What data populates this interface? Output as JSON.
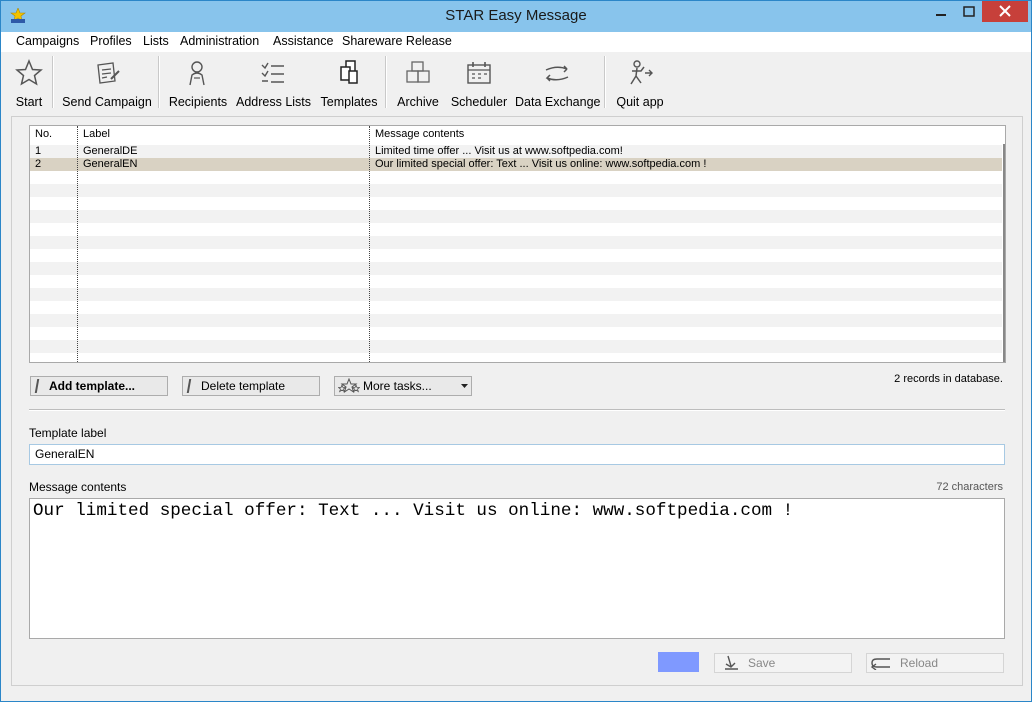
{
  "window": {
    "title": "STAR Easy Message"
  },
  "menu": [
    "Campaigns",
    "Profiles",
    "Lists",
    "Administration",
    "Assistance",
    "Shareware Release"
  ],
  "toolbar": [
    {
      "label": "Start",
      "icon": "star-icon"
    },
    {
      "label": "Send Campaign",
      "icon": "send-campaign-icon"
    },
    {
      "label": "Recipients",
      "icon": "recipients-icon"
    },
    {
      "label": "Address Lists",
      "icon": "address-lists-icon"
    },
    {
      "label": "Templates",
      "icon": "templates-icon"
    },
    {
      "label": "Archive",
      "icon": "archive-icon"
    },
    {
      "label": "Scheduler",
      "icon": "scheduler-icon"
    },
    {
      "label": "Data Exchange",
      "icon": "data-exchange-icon"
    },
    {
      "label": "Quit app",
      "icon": "quit-icon"
    }
  ],
  "grid": {
    "columns": [
      "No.",
      "Label",
      "Message contents"
    ],
    "rows": [
      {
        "no": "1",
        "label": "GeneralDE",
        "content": "Limited time offer ... Visit us at www.softpedia.com!"
      },
      {
        "no": "2",
        "label": "GeneralEN",
        "content": "Our limited special offer: Text ... Visit us online: www.softpedia.com !",
        "selected": true
      }
    ]
  },
  "buttons": {
    "add": "Add template...",
    "delete": "Delete template",
    "more": "More tasks..."
  },
  "records_text": "2 records in database.",
  "template_label": {
    "label": "Template label",
    "value": "GeneralEN"
  },
  "message": {
    "label": "Message contents",
    "count": "72 characters",
    "text": "Our limited special offer: Text ... Visit us online: www.softpedia.com !"
  },
  "footer": {
    "save": "Save",
    "reload": "Reload",
    "swatch_color": "#7f99ff"
  }
}
